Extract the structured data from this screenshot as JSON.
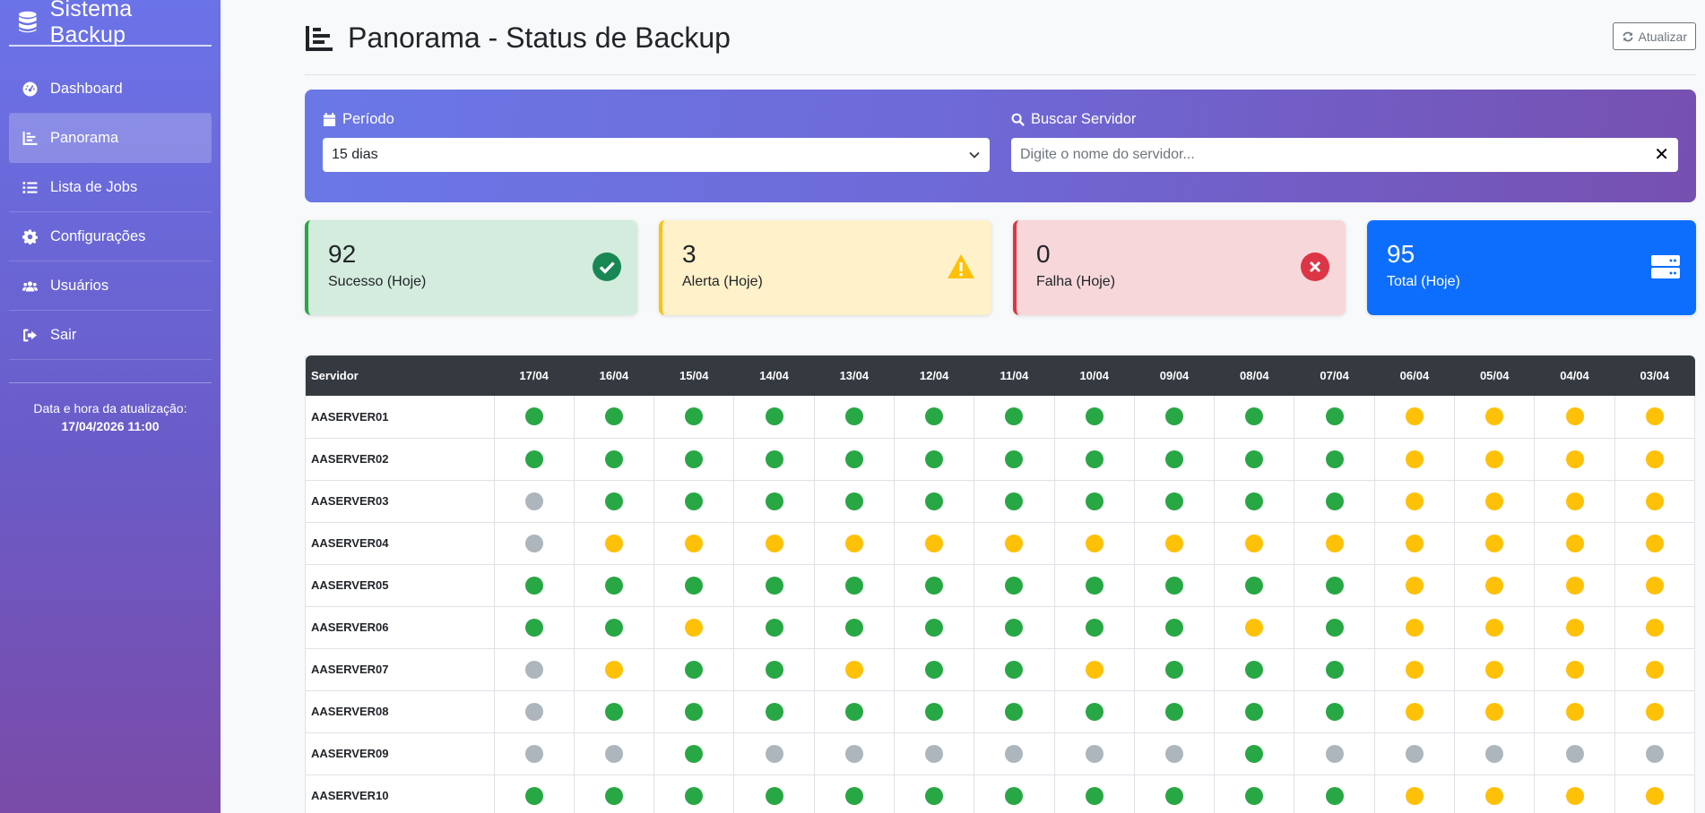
{
  "sidebar": {
    "brand": "Sistema Backup",
    "items": [
      {
        "label": "Dashboard",
        "icon": "dashboard-icon"
      },
      {
        "label": "Panorama",
        "icon": "chart-icon",
        "active": true
      },
      {
        "label": "Lista de Jobs",
        "icon": "list-icon"
      },
      {
        "label": "Configurações",
        "icon": "gear-icon"
      },
      {
        "label": "Usuários",
        "icon": "users-icon"
      },
      {
        "label": "Sair",
        "icon": "logout-icon"
      }
    ],
    "update_label": "Data e hora da atualização:",
    "update_value": "17/04/2026 11:00"
  },
  "header": {
    "title": "Panorama - Status de Backup",
    "refresh_label": "Atualizar"
  },
  "filters": {
    "period_label": "Período",
    "period_value": "15 dias",
    "search_label": "Buscar Servidor",
    "search_placeholder": "Digite o nome do servidor...",
    "clear_label": "✕"
  },
  "cards": {
    "success": {
      "value": "92",
      "label": "Sucesso (Hoje)"
    },
    "warning": {
      "value": "3",
      "label": "Alerta (Hoje)"
    },
    "failure": {
      "value": "0",
      "label": "Falha (Hoje)"
    },
    "total": {
      "value": "95",
      "label": "Total (Hoje)"
    }
  },
  "colors": {
    "success": "#28a745",
    "warning": "#ffc107",
    "failure": "#dc3545",
    "none": "#adb5bd",
    "total": "#0d6efd"
  },
  "table": {
    "server_header": "Servidor",
    "dates": [
      "17/04",
      "16/04",
      "15/04",
      "14/04",
      "13/04",
      "12/04",
      "11/04",
      "10/04",
      "09/04",
      "08/04",
      "07/04",
      "06/04",
      "05/04",
      "04/04",
      "03/04"
    ],
    "rows": [
      {
        "server": "AASERVER01",
        "status": [
          "s",
          "s",
          "s",
          "s",
          "s",
          "s",
          "s",
          "s",
          "s",
          "s",
          "s",
          "w",
          "w",
          "w",
          "w"
        ]
      },
      {
        "server": "AASERVER02",
        "status": [
          "s",
          "s",
          "s",
          "s",
          "s",
          "s",
          "s",
          "s",
          "s",
          "s",
          "s",
          "w",
          "w",
          "w",
          "w"
        ]
      },
      {
        "server": "AASERVER03",
        "status": [
          "n",
          "s",
          "s",
          "s",
          "s",
          "s",
          "s",
          "s",
          "s",
          "s",
          "s",
          "w",
          "w",
          "w",
          "w"
        ]
      },
      {
        "server": "AASERVER04",
        "status": [
          "n",
          "w",
          "w",
          "w",
          "w",
          "w",
          "w",
          "w",
          "w",
          "w",
          "w",
          "w",
          "w",
          "w",
          "w"
        ]
      },
      {
        "server": "AASERVER05",
        "status": [
          "s",
          "s",
          "s",
          "s",
          "s",
          "s",
          "s",
          "s",
          "s",
          "s",
          "s",
          "w",
          "w",
          "w",
          "w"
        ]
      },
      {
        "server": "AASERVER06",
        "status": [
          "s",
          "s",
          "w",
          "s",
          "s",
          "s",
          "s",
          "s",
          "s",
          "w",
          "s",
          "w",
          "w",
          "w",
          "w"
        ]
      },
      {
        "server": "AASERVER07",
        "status": [
          "n",
          "w",
          "s",
          "s",
          "w",
          "s",
          "s",
          "w",
          "s",
          "s",
          "s",
          "w",
          "w",
          "w",
          "w"
        ]
      },
      {
        "server": "AASERVER08",
        "status": [
          "n",
          "s",
          "s",
          "s",
          "s",
          "s",
          "s",
          "s",
          "s",
          "s",
          "s",
          "w",
          "w",
          "w",
          "w"
        ]
      },
      {
        "server": "AASERVER09",
        "status": [
          "n",
          "n",
          "s",
          "n",
          "n",
          "n",
          "n",
          "n",
          "n",
          "s",
          "n",
          "n",
          "n",
          "n",
          "n"
        ]
      },
      {
        "server": "AASERVER10",
        "status": [
          "s",
          "s",
          "s",
          "s",
          "s",
          "s",
          "s",
          "s",
          "s",
          "s",
          "s",
          "w",
          "w",
          "w",
          "w"
        ]
      }
    ]
  }
}
